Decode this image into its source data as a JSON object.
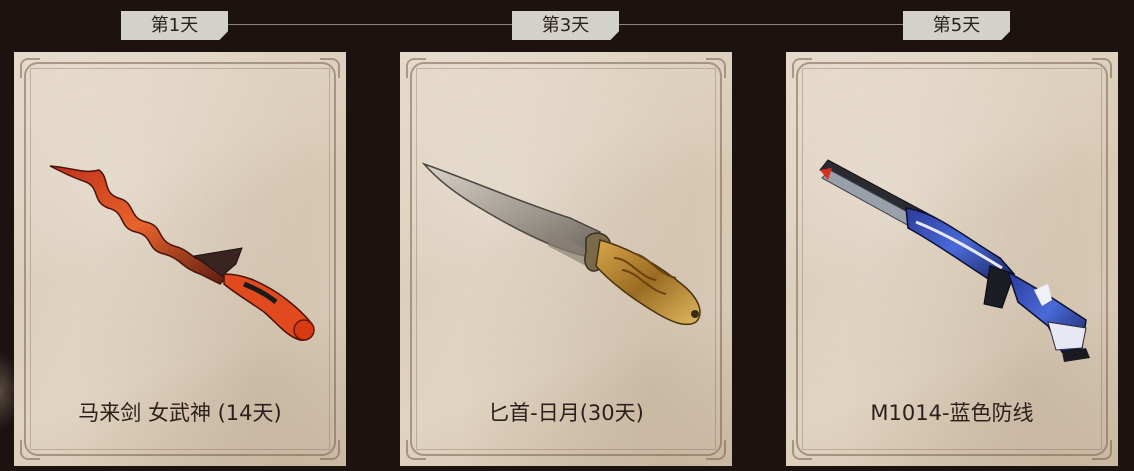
{
  "timeline": {
    "days": [
      {
        "label": "第1天"
      },
      {
        "label": "第3天"
      },
      {
        "label": "第5天"
      }
    ]
  },
  "rewards": [
    {
      "name": "马来剑 女武神 (14天)",
      "icon": "kris-sword-icon"
    },
    {
      "name": "匕首-日月(30天)",
      "icon": "dagger-icon"
    },
    {
      "name": "M1014-蓝色防线",
      "icon": "shotgun-icon"
    }
  ],
  "colors": {
    "background": "#1c1210",
    "tab": "#d4d0cb",
    "card": "#ddd0bf",
    "text": "#2b201b"
  }
}
